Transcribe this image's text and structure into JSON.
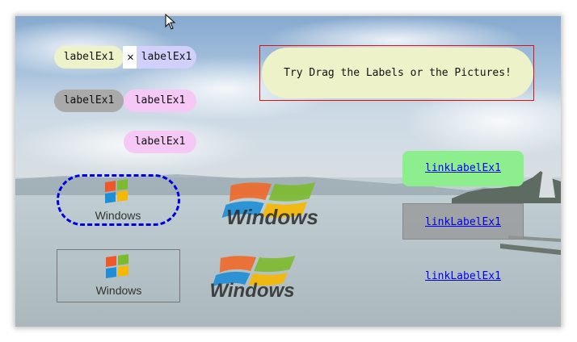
{
  "labels": {
    "top_left": "labelEx1",
    "close_symbol": "✕",
    "top_right": "labelEx1",
    "mid_left": "labelEx1",
    "mid_right": "labelEx1",
    "bottom": "labelEx1"
  },
  "banner": {
    "text": "Try Drag the Labels or the Pictures!"
  },
  "links": [
    {
      "text": "linkLabelEx1"
    },
    {
      "text": "linkLabelEx1"
    },
    {
      "text": "linkLabelEx1"
    }
  ],
  "logos": {
    "wordmark": "Windows"
  },
  "colors": {
    "pill_cream": "#eef2c8",
    "pill_lavender": "#d0d0fa",
    "pill_gray": "#a9a9a9",
    "pill_pink": "#f5c8f5",
    "link_green": "#8dee8d",
    "dashed_blue": "#0000dd",
    "banner_border": "#e01010"
  }
}
